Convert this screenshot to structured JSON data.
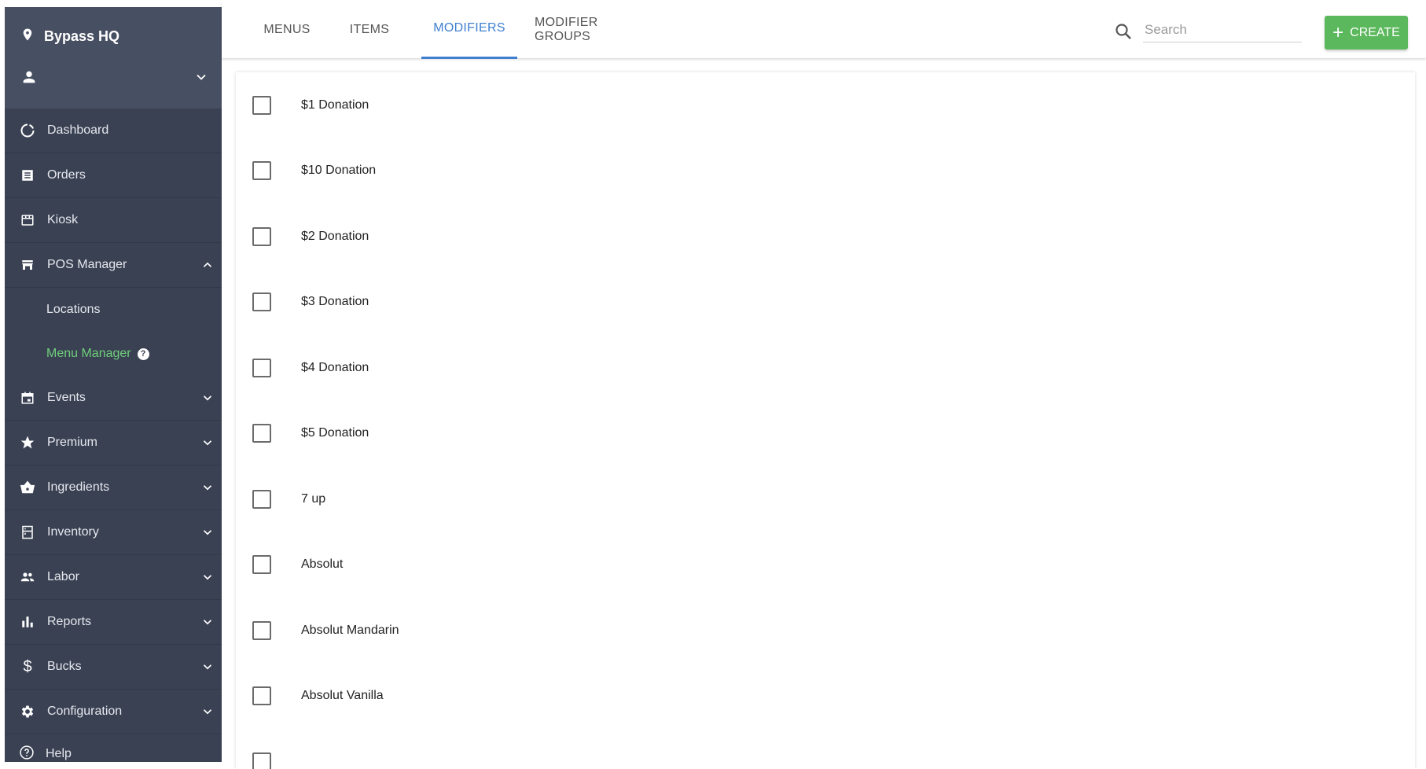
{
  "sidebar": {
    "location": "Bypass HQ",
    "items": [
      {
        "label": "Dashboard",
        "icon": "dashboard-icon",
        "expandable": false
      },
      {
        "label": "Orders",
        "icon": "orders-icon",
        "expandable": false
      },
      {
        "label": "Kiosk",
        "icon": "kiosk-icon",
        "expandable": false
      },
      {
        "label": "POS Manager",
        "icon": "store-icon",
        "expandable": true,
        "expanded": true
      }
    ],
    "subitems": [
      {
        "label": "Locations",
        "active": false
      },
      {
        "label": "Menu Manager",
        "active": true
      }
    ],
    "items_after": [
      {
        "label": "Events",
        "icon": "calendar-icon"
      },
      {
        "label": "Premium",
        "icon": "star-icon"
      },
      {
        "label": "Ingredients",
        "icon": "basket-icon"
      },
      {
        "label": "Inventory",
        "icon": "inventory-icon"
      },
      {
        "label": "Labor",
        "icon": "people-icon"
      },
      {
        "label": "Reports",
        "icon": "bar-chart-icon"
      },
      {
        "label": "Bucks",
        "icon": "dollar-icon"
      },
      {
        "label": "Configuration",
        "icon": "gear-icon"
      }
    ],
    "help": "Help"
  },
  "tabs": [
    {
      "label": "MENUS",
      "active": false
    },
    {
      "label": "ITEMS",
      "active": false
    },
    {
      "label": "MODIFIERS",
      "active": true
    },
    {
      "label": "MODIFIER GROUPS",
      "active": false
    }
  ],
  "search": {
    "placeholder": "Search",
    "value": ""
  },
  "create_label": "CREATE",
  "modifiers": [
    "$1 Donation",
    "$10 Donation",
    "$2 Donation",
    "$3 Donation",
    "$4 Donation",
    "$5 Donation",
    "7 up",
    "Absolut",
    "Absolut Mandarin",
    "Absolut Vanilla"
  ],
  "colors": {
    "sidebar_bg": "#3a4153",
    "accent_blue": "#3f7fd0",
    "active_green": "#6fcf7a",
    "create_green": "#5cb85c"
  }
}
